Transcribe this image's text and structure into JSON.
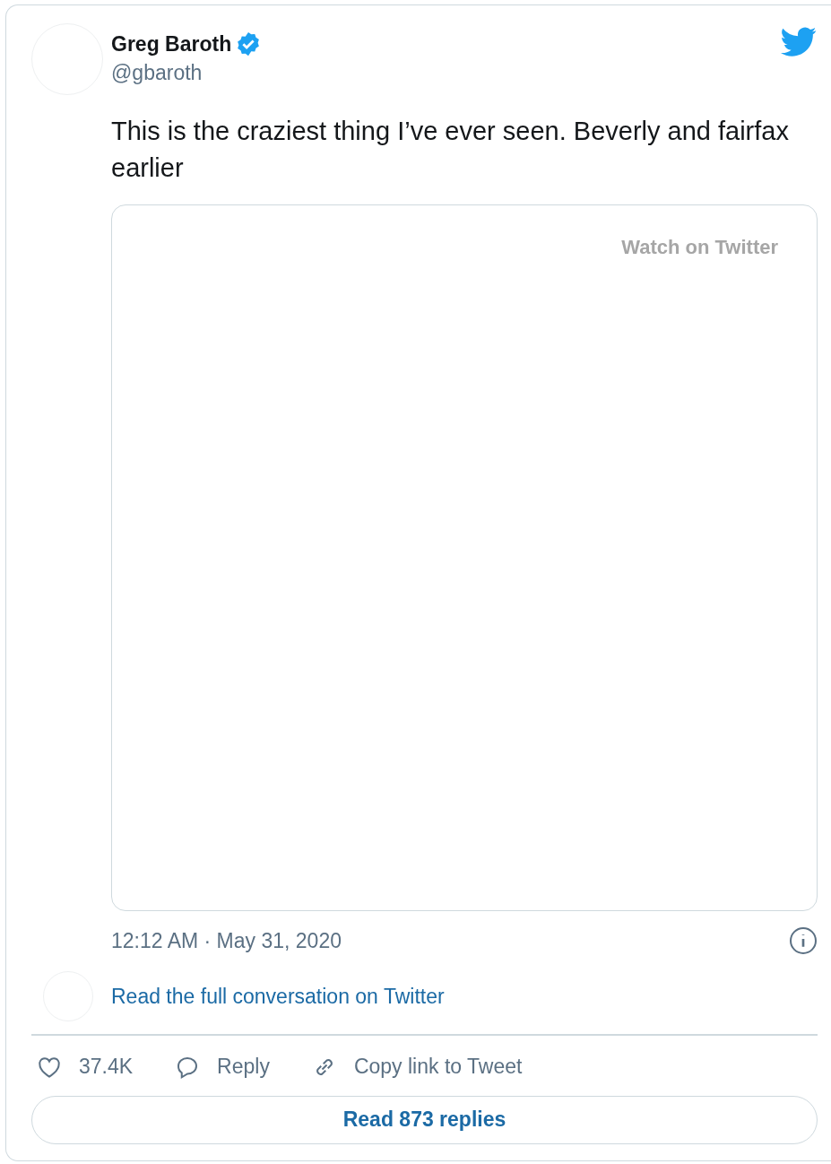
{
  "author": {
    "name": "Greg Baroth",
    "verified": true,
    "handle": "@gbaroth"
  },
  "text": "This is the craziest thing I’ve ever seen. Beverly and fairfax earlier",
  "media": {
    "label": "Watch on Twitter"
  },
  "timestamp": "12:12 AM · May 31, 2020",
  "conversation_link": "Read the full conversation on Twitter",
  "actions": [
    {
      "kind": "like",
      "label": "37.4K"
    },
    {
      "kind": "reply",
      "label": "Reply"
    },
    {
      "kind": "copy",
      "label": "Copy link to Tweet"
    }
  ],
  "read_replies": "Read 873 replies"
}
